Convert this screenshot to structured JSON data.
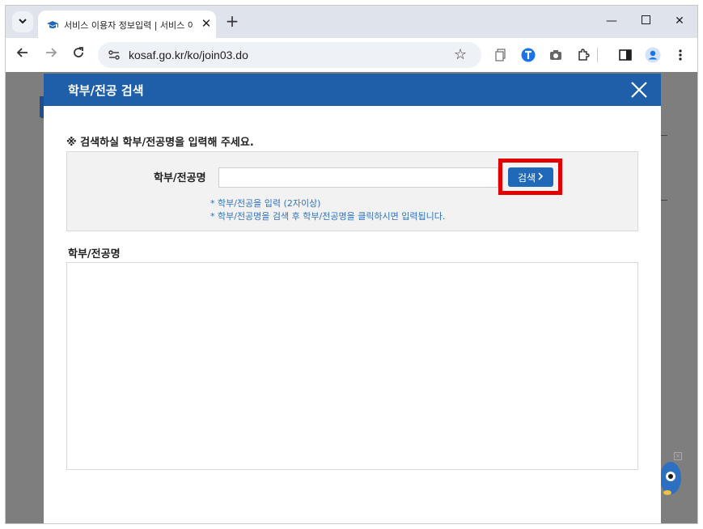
{
  "tab": {
    "title": "서비스 이용자 정보입력 | 서비스 이용",
    "new_tab_symbol": "+"
  },
  "omnibox": {
    "url": "kosaf.go.kr/ko/join03.do"
  },
  "modal": {
    "title": "학부/전공 검색",
    "notice": "※ 검색하실 학부/전공명을 입력해 주세요.",
    "field_label": "학부/전공명",
    "input_value": "",
    "search_button_label": "검색",
    "hints": [
      "* 학부/전공을 입력 (2자이상)",
      "* 학부/전공명을 검색 후 학부/전공명을 클릭하시면 입력됩니다."
    ],
    "result_label": "학부/전공명"
  },
  "colors": {
    "modal_header": "#1f5fa9",
    "search_button": "#1f69b8",
    "highlight": "#e20000",
    "hint_text": "#2f73c0"
  },
  "icons": {
    "tab_search": "chevron-down-icon",
    "favicon": "graduation-cap-icon",
    "back": "arrow-left-icon",
    "forward": "arrow-right-icon",
    "reload": "reload-icon",
    "site_info": "tune-icon",
    "bookmark": "star-icon",
    "modal_close": "close-icon"
  }
}
